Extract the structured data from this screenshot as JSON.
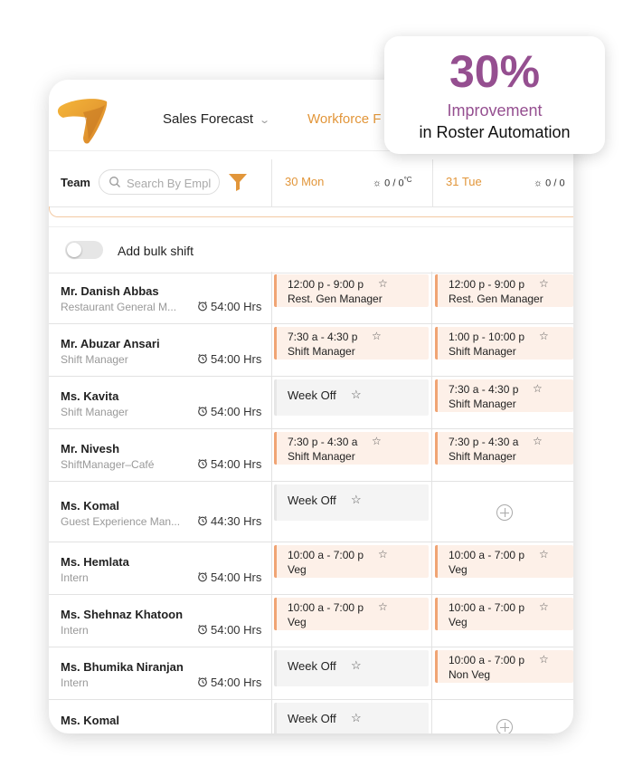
{
  "nav": {
    "sales_forecast": "Sales Forecast",
    "workforce": "Workforce F"
  },
  "filter": {
    "team_label": "Team",
    "search_placeholder": "Search By Empl"
  },
  "days": [
    {
      "label": "30 Mon",
      "weather": "0 / 0",
      "unit": "°C"
    },
    {
      "label": "31 Tue",
      "weather": "0 / 0",
      "unit": ""
    }
  ],
  "bulk": {
    "label": "Add bulk shift",
    "enabled": false
  },
  "employees": [
    {
      "name": "Mr. Danish Abbas",
      "role": "Restaurant General M...",
      "hours": "54:00 Hrs",
      "shifts": [
        {
          "type": "shift",
          "time": "12:00 p - 9:00 p",
          "role": "Rest. Gen Manager"
        },
        {
          "type": "shift",
          "time": "12:00 p - 9:00 p",
          "role": "Rest. Gen Manager"
        }
      ]
    },
    {
      "name": "Mr. Abuzar Ansari",
      "role": "Shift Manager",
      "hours": "54:00 Hrs",
      "shifts": [
        {
          "type": "shift",
          "time": "7:30 a - 4:30 p",
          "role": "Shift Manager"
        },
        {
          "type": "shift",
          "time": "1:00 p - 10:00 p",
          "role": "Shift Manager"
        }
      ]
    },
    {
      "name": "Ms. Kavita",
      "role": "Shift Manager",
      "hours": "54:00 Hrs",
      "shifts": [
        {
          "type": "off",
          "label": "Week Off"
        },
        {
          "type": "shift",
          "time": "7:30 a - 4:30 p",
          "role": "Shift Manager"
        }
      ]
    },
    {
      "name": "Mr. Nivesh",
      "role": "ShiftManager–Café",
      "hours": "54:00 Hrs",
      "shifts": [
        {
          "type": "shift",
          "time": "7:30 p - 4:30 a",
          "role": "Shift Manager"
        },
        {
          "type": "shift",
          "time": "7:30 p - 4:30 a",
          "role": "Shift Manager"
        }
      ]
    },
    {
      "name": "Ms. Komal",
      "role": "Guest Experience Man...",
      "hours": "44:30 Hrs",
      "shifts": [
        {
          "type": "off",
          "label": "Week Off"
        },
        {
          "type": "add"
        }
      ]
    },
    {
      "name": "Ms. Hemlata",
      "role": "Intern",
      "hours": "54:00 Hrs",
      "shifts": [
        {
          "type": "shift",
          "time": "10:00 a - 7:00 p",
          "role": "Veg"
        },
        {
          "type": "shift",
          "time": "10:00 a - 7:00 p",
          "role": "Veg"
        }
      ]
    },
    {
      "name": "Ms. Shehnaz Khatoon",
      "role": "Intern",
      "hours": "54:00 Hrs",
      "shifts": [
        {
          "type": "shift",
          "time": "10:00 a - 7:00 p",
          "role": "Veg"
        },
        {
          "type": "shift",
          "time": "10:00 a - 7:00 p",
          "role": "Veg"
        }
      ]
    },
    {
      "name": "Ms. Bhumika Niranjan",
      "role": "Intern",
      "hours": "54:00 Hrs",
      "shifts": [
        {
          "type": "off",
          "label": "Week Off"
        },
        {
          "type": "shift",
          "time": "10:00 a - 7:00 p",
          "role": "Non Veg"
        }
      ]
    },
    {
      "name": "Ms. Komal",
      "role": "",
      "hours": "",
      "shifts": [
        {
          "type": "off",
          "label": "Week Off"
        },
        {
          "type": "add"
        }
      ]
    }
  ],
  "promo": {
    "percent": "30%",
    "line1": "Improvement",
    "line2": "in Roster Automation"
  },
  "icons": {
    "logo": "brand-logo",
    "search": "search-icon",
    "filter": "filter-icon",
    "weather": "sun-icon",
    "clock": "alarm-clock-icon",
    "star": "star-icon",
    "add": "plus-circle-icon"
  },
  "colors": {
    "accent": "#e2963a",
    "promo": "#954f90",
    "shift_bg": "#fdf0e8",
    "shift_border": "#f0a474"
  }
}
